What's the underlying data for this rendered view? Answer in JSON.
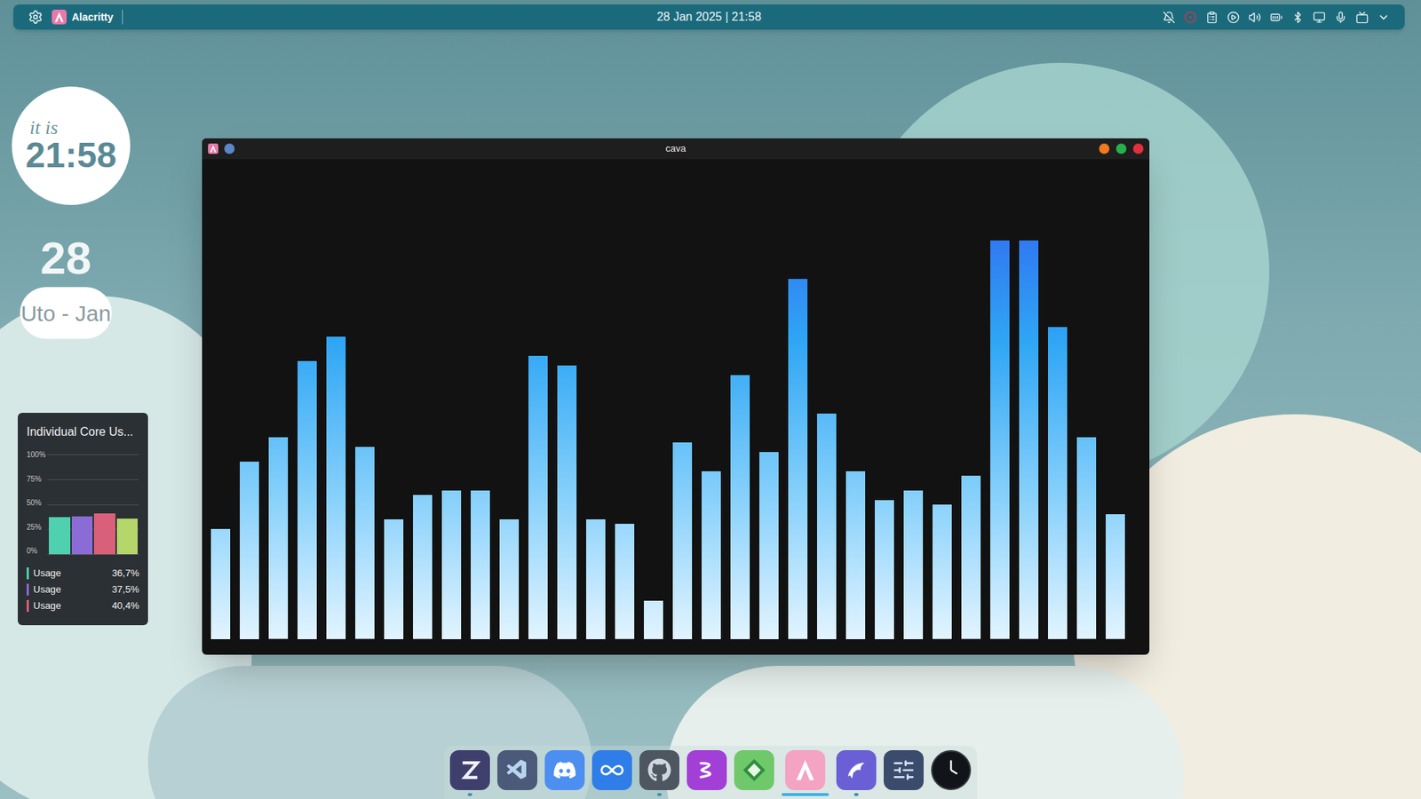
{
  "top_bar": {
    "app_name": "Alacritty",
    "datetime": "28 Jan 2025 | 21:58"
  },
  "clock": {
    "prefix": "it is",
    "time": "21:58"
  },
  "date": {
    "day": "28",
    "label": "Uto - Jan"
  },
  "core_usage": {
    "title": "Individual Core Us...",
    "ticks": [
      "100%",
      "75%",
      "50%",
      "25%",
      "0%"
    ],
    "bars": [
      {
        "value": 36.7,
        "color": "#4fd1b0"
      },
      {
        "value": 37.5,
        "color": "#8b6cd6"
      },
      {
        "value": 40.4,
        "color": "#d9607a"
      },
      {
        "value": 35.4,
        "color": "#b5d66a"
      }
    ],
    "legend": [
      {
        "label": "Usage",
        "reading": "36,7%",
        "color": "#4fd1b0"
      },
      {
        "label": "Usage",
        "reading": "37,5%",
        "color": "#8b6cd6"
      },
      {
        "label": "Usage",
        "reading": "40,4%",
        "color": "#d9607a"
      }
    ]
  },
  "window": {
    "title": "cava",
    "levels": [
      0.23,
      0.37,
      0.42,
      0.58,
      0.63,
      0.4,
      0.25,
      0.3,
      0.31,
      0.31,
      0.25,
      0.59,
      0.57,
      0.25,
      0.24,
      0.08,
      0.41,
      0.35,
      0.55,
      0.39,
      0.75,
      0.47,
      0.35,
      0.29,
      0.31,
      0.28,
      0.34,
      0.83,
      0.83,
      0.65,
      0.42,
      0.26
    ]
  },
  "dock": {
    "items": [
      {
        "kind": "zed",
        "running": true,
        "selected": false
      },
      {
        "kind": "vscode",
        "running": false,
        "selected": false
      },
      {
        "kind": "discord",
        "running": false,
        "selected": false
      },
      {
        "kind": "arduino",
        "running": false,
        "selected": false
      },
      {
        "kind": "github",
        "running": true,
        "selected": false
      },
      {
        "kind": "emacs",
        "running": false,
        "selected": false
      },
      {
        "kind": "vim",
        "running": false,
        "selected": false
      },
      {
        "kind": "alacritty",
        "running": true,
        "selected": true
      },
      {
        "kind": "dolphin",
        "running": true,
        "selected": false
      },
      {
        "kind": "mixer",
        "running": false,
        "selected": false
      },
      {
        "kind": "clock",
        "running": false,
        "selected": false
      }
    ]
  }
}
